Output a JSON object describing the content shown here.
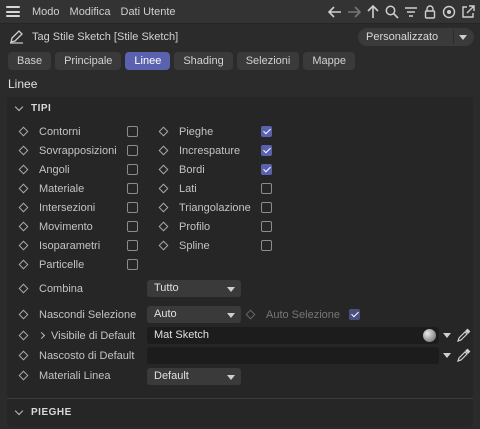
{
  "menubar": {
    "items": [
      "Modo",
      "Modifica",
      "Dati Utente"
    ],
    "icons": [
      "arrow-left-icon",
      "arrow-right-icon",
      "arrow-up-icon",
      "search-icon",
      "filter-icon",
      "lock-icon",
      "target-icon",
      "new-window-icon"
    ]
  },
  "header": {
    "title": "Tag Stile Sketch [Stile Sketch]",
    "preset": "Personalizzato"
  },
  "tabs": [
    {
      "label": "Base",
      "active": false
    },
    {
      "label": "Principale",
      "active": false
    },
    {
      "label": "Linee",
      "active": true
    },
    {
      "label": "Shading",
      "active": false
    },
    {
      "label": "Selezioni",
      "active": false
    },
    {
      "label": "Mappe",
      "active": false
    }
  ],
  "section_title": "Linee",
  "groups": {
    "tipi": "TIPI",
    "pieghe": "PIEGHE"
  },
  "tipi_left": [
    {
      "label": "Contorni",
      "checked": false
    },
    {
      "label": "Sovrapposizioni",
      "checked": false
    },
    {
      "label": "Angoli",
      "checked": false
    },
    {
      "label": "Materiale",
      "checked": false
    },
    {
      "label": "Intersezioni",
      "checked": false
    },
    {
      "label": "Movimento",
      "checked": false
    },
    {
      "label": "Isoparametri",
      "checked": false
    },
    {
      "label": "Particelle",
      "checked": false
    }
  ],
  "tipi_right": [
    {
      "label": "Pieghe",
      "checked": true
    },
    {
      "label": "Increspature",
      "checked": true
    },
    {
      "label": "Bordi",
      "checked": true
    },
    {
      "label": "Lati",
      "checked": false
    },
    {
      "label": "Triangolazione",
      "checked": false
    },
    {
      "label": "Profilo",
      "checked": false
    },
    {
      "label": "Spline",
      "checked": false
    }
  ],
  "combina": {
    "label": "Combina",
    "value": "Tutto"
  },
  "nascondi_selezione": {
    "label": "Nascondi Selezione",
    "value": "Auto"
  },
  "auto_selezione": {
    "label": "Auto Selezione",
    "checked": true
  },
  "visibile_default": {
    "label": "Visibile di Default",
    "value": "Mat Sketch"
  },
  "nascosto_default": {
    "label": "Nascosto di Default",
    "value": ""
  },
  "materiali_linea": {
    "label": "Materiali Linea",
    "value": "Default"
  },
  "colors": {
    "accent": "#5a62b0",
    "panel": "#262626",
    "background": "#2b2b2b"
  }
}
